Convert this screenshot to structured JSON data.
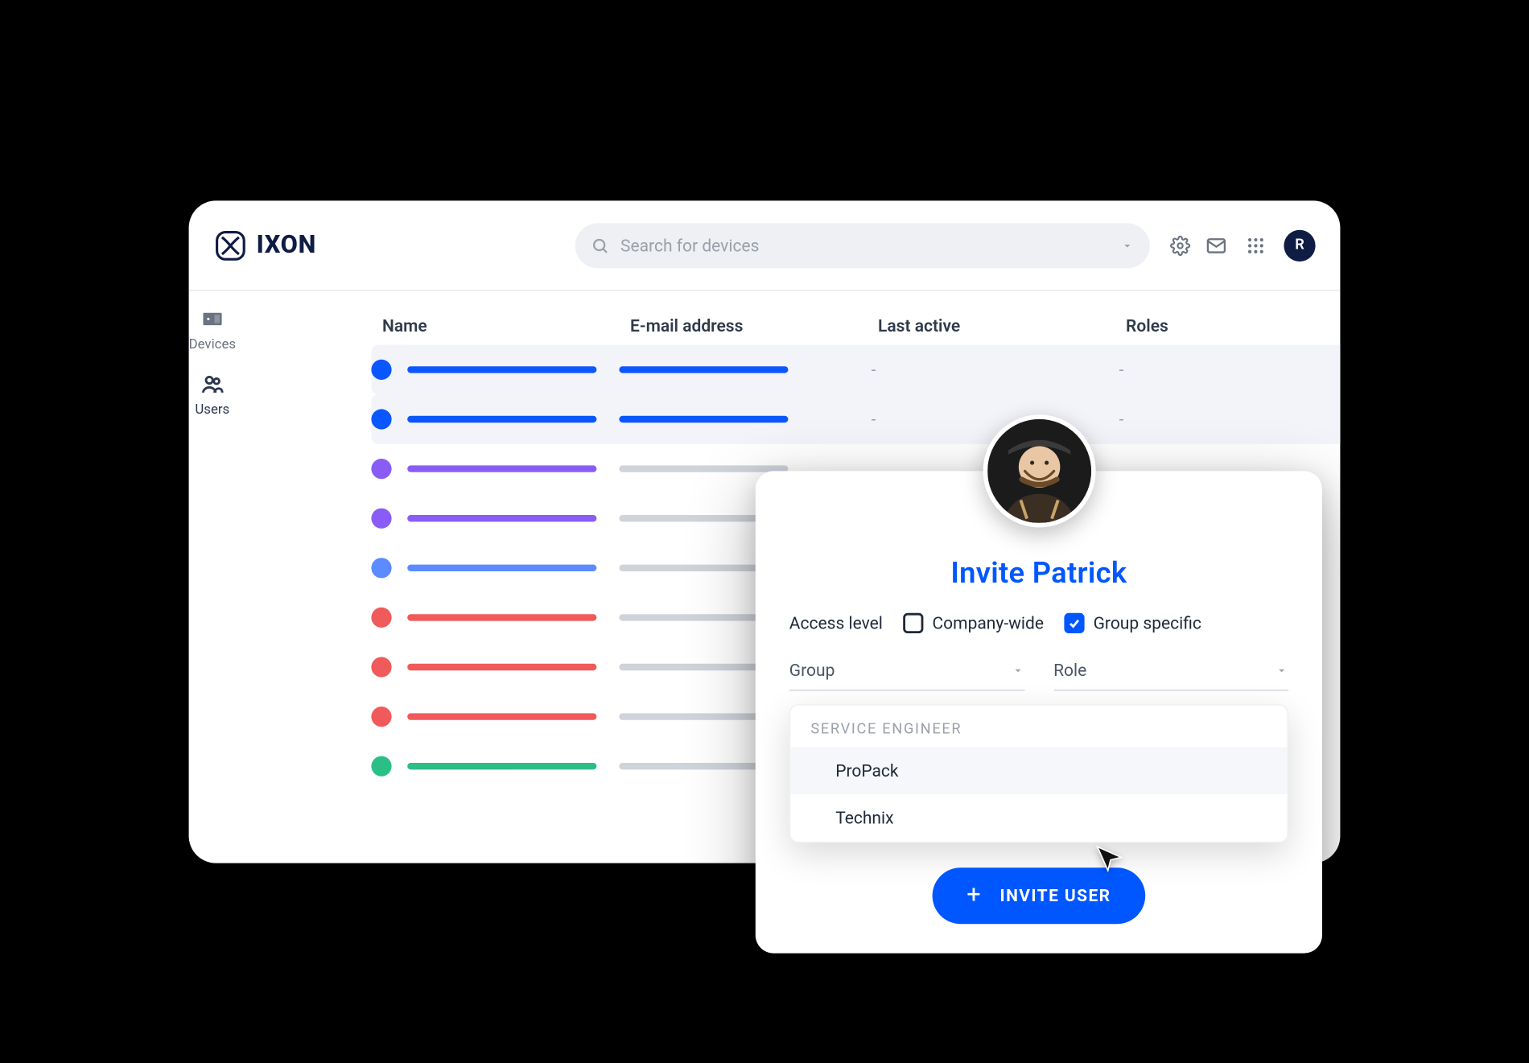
{
  "brand": {
    "name": "IXON"
  },
  "search": {
    "placeholder": "Search for devices"
  },
  "avatar_initial": "R",
  "sidebar": {
    "items": [
      {
        "label": "Devices"
      },
      {
        "label": "Users"
      }
    ]
  },
  "columns": {
    "name": "Name",
    "email": "E-mail address",
    "last_active": "Last active",
    "roles": "Roles"
  },
  "rows": [
    {
      "selected": true,
      "dot": "#0b57ff",
      "name_bar": "#0b57ff",
      "email_bar": "#0b57ff",
      "last_active": "-",
      "roles": "-"
    },
    {
      "selected": true,
      "dot": "#0b57ff",
      "name_bar": "#0b57ff",
      "email_bar": "#0b57ff",
      "last_active": "-",
      "roles": "-"
    },
    {
      "selected": false,
      "dot": "#8a5cf6",
      "name_bar": "#8a5cf6",
      "email_bar": "#cfd3da",
      "last_active": "",
      "roles": ""
    },
    {
      "selected": false,
      "dot": "#8a5cf6",
      "name_bar": "#8a5cf6",
      "email_bar": "#cfd3da",
      "last_active": "",
      "roles": ""
    },
    {
      "selected": false,
      "dot": "#5b8bff",
      "name_bar": "#5b8bff",
      "email_bar": "#cfd3da",
      "last_active": "",
      "roles": ""
    },
    {
      "selected": false,
      "dot": "#f05a5a",
      "name_bar": "#f05a5a",
      "email_bar": "#cfd3da",
      "last_active": "",
      "roles": ""
    },
    {
      "selected": false,
      "dot": "#f05a5a",
      "name_bar": "#f05a5a",
      "email_bar": "#cfd3da",
      "last_active": "",
      "roles": ""
    },
    {
      "selected": false,
      "dot": "#f05a5a",
      "name_bar": "#f05a5a",
      "email_bar": "#cfd3da",
      "last_active": "",
      "roles": ""
    },
    {
      "selected": false,
      "dot": "#2bbf88",
      "name_bar": "#2bbf88",
      "email_bar": "#cfd3da",
      "last_active": "",
      "roles": ""
    }
  ],
  "modal": {
    "title": "Invite Patrick",
    "access_label": "Access level",
    "company_wide": "Company-wide",
    "group_specific": "Group specific",
    "group_label": "Group",
    "role_label": "Role",
    "dropdown_heading": "SERVICE ENGINEER",
    "options": [
      {
        "label": "ProPack",
        "active": true
      },
      {
        "label": "Technix",
        "active": false
      }
    ],
    "invite_button": "INVITE USER"
  }
}
